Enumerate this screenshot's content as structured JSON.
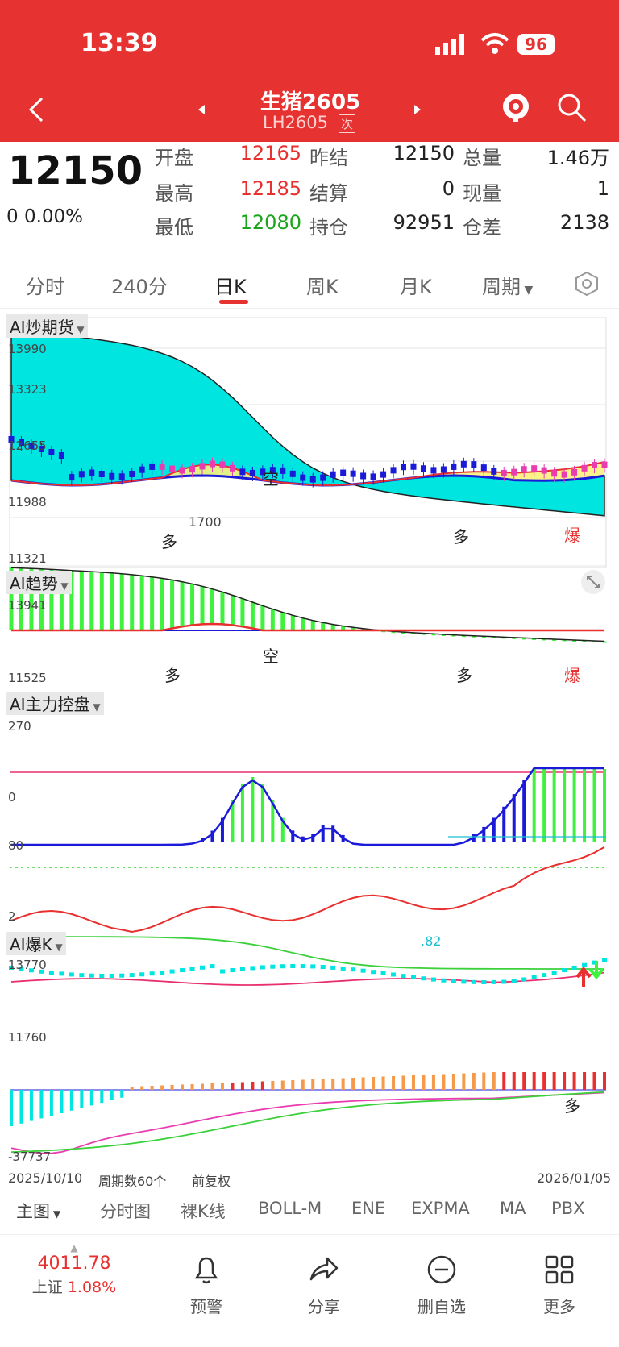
{
  "status": {
    "time": "13:39",
    "battery": "96"
  },
  "nav": {
    "title": "生猪2605",
    "code": "LH2605",
    "badge": "次"
  },
  "quote": {
    "price": "12150",
    "change": "0",
    "change_pct": "0.00%",
    "rows": [
      {
        "l1": "开盘",
        "v1": "12165",
        "l2": "昨结",
        "v2": "12150",
        "l3": "总量",
        "v3": "1.46万"
      },
      {
        "l1": "最高",
        "v1": "12185",
        "l2": "结算",
        "v2": "0",
        "l3": "现量",
        "v3": "1"
      },
      {
        "l1": "最低",
        "v1": "12080",
        "l2": "持仓",
        "v2": "92951",
        "l3": "仓差",
        "v3": "2138"
      }
    ]
  },
  "tabs": [
    "分时",
    "240分",
    "日K",
    "周K",
    "月K",
    "周期"
  ],
  "active_tab": "日K",
  "panels": {
    "main": {
      "name": "AI炒期货",
      "y_top": "13990",
      "y_2": "13323",
      "y_3": "12655",
      "y_4": "11988",
      "y_bottom": "11321",
      "mark_kong": "空",
      "mark_duo1": "多",
      "mark_duo2": "多",
      "mark_bao": "爆",
      "price_label": "1700"
    },
    "trend": {
      "name": "AI趋势",
      "y_top": "13941",
      "y_bottom": "11525",
      "mark_kong": "空",
      "mark_duo1": "多",
      "mark_duo2": "多",
      "mark_bao": "爆"
    },
    "control": {
      "name": "AI主力控盘",
      "y_top": "270",
      "y_bottom": "0"
    },
    "line": {
      "y_top": "80",
      "y_bottom": "2"
    },
    "baok": {
      "name": "AI爆K",
      "y_top": "13770",
      "y_bottom": "11760",
      "stray": ".82"
    },
    "flow": {
      "y_bottom": "-37737",
      "mark_duo": "多"
    }
  },
  "footer_info": {
    "start_date": "2025/10/10",
    "period": "周期数60个",
    "adjust": "前复权",
    "end_date": "2026/01/05"
  },
  "indicators": [
    "主图",
    "分时图",
    "裸K线",
    "BOLL-M",
    "ENE",
    "EXPMA",
    "MA",
    "PBX"
  ],
  "index": {
    "value": "4011.78",
    "name": "上证",
    "pct": "1.08%"
  },
  "bottom_nav": [
    {
      "label": "预警",
      "icon": "bell-icon"
    },
    {
      "label": "分享",
      "icon": "share-icon"
    },
    {
      "label": "删自选",
      "icon": "minus-circle-icon"
    },
    {
      "label": "更多",
      "icon": "grid-icon"
    }
  ],
  "colors": {
    "accent": "#e63230",
    "up": "#e8302f",
    "down": "#1aa51a",
    "cloud": "#00e5e0"
  }
}
